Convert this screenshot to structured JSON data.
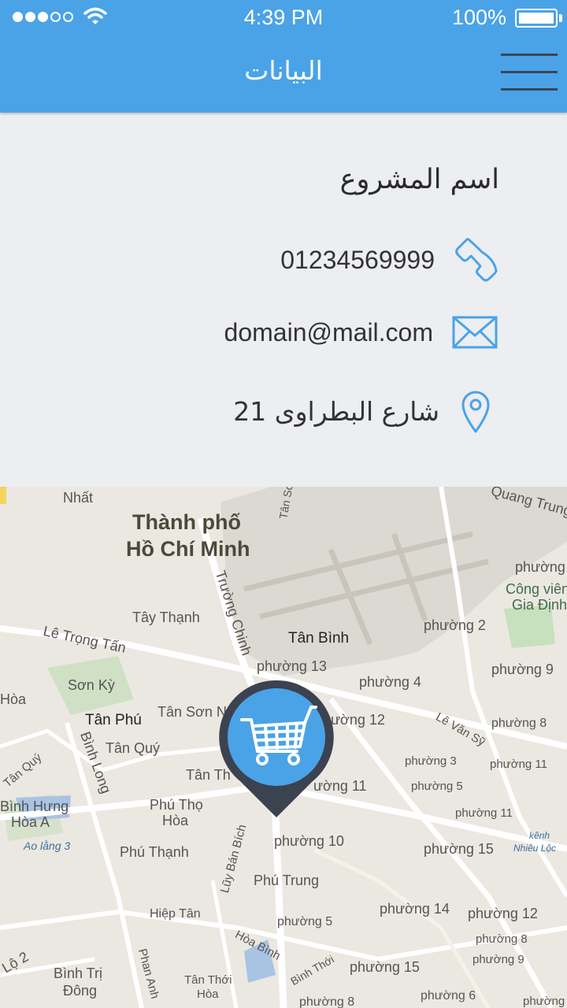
{
  "status_bar": {
    "time": "4:39 PM",
    "battery": "100%"
  },
  "header": {
    "title": "البيانات"
  },
  "contact": {
    "project_name": "اسم المشروع",
    "phone": "01234569999",
    "email": "domain@mail.com",
    "address": "21 شارع البطراوى"
  },
  "icons": {
    "phone": "phone-icon",
    "email": "envelope-icon",
    "address": "location-pin-icon",
    "pin": "shopping-cart-icon"
  },
  "colors": {
    "accent": "#4aa3e6",
    "pin_dark": "#3b4250"
  },
  "map": {
    "labels": {
      "nhat": "Nhất",
      "city1": "Thành phố",
      "city2": "Hồ Chí Minh",
      "tan_sn": "Tân Sơ",
      "quang_trung": "Quang Trung",
      "phuong_tr": "phường",
      "cong_vien": "Công viên",
      "gia_dinh": "Gia Định",
      "truong_chinh": "Trường Chinh",
      "tay_thanh": "Tây Thạnh",
      "le_trong_tan": "Lê Trọng Tấn",
      "tan_binh": "Tân Bình",
      "p2": "phường 2",
      "p13": "phường 13",
      "p9a": "phường 9",
      "son_ky": "Sơn Kỳ",
      "p4": "phường 4",
      "hoa": "Hòa",
      "tan_phu": "Tân Phú",
      "tan_son_n": "Tân Sơn N",
      "p12a": "ường 12",
      "le_van_sy": "Lê Văn Sỹ",
      "p8": "phường 8",
      "tan_quy": "Tân Quý",
      "binh_long": "Bình Long",
      "tan_quy2": "Tân Quý",
      "p3": "phường 3",
      "p11a": "phường 11",
      "tan_th": "Tân Th",
      "p11b": "ường 11",
      "p5a": "phường 5",
      "binh_hung": "Bình Hưng",
      "hoa_a": "Hòa A",
      "phu_tho": "Phú Thọ",
      "hoa2": "Hòa",
      "p11c": "phường 11",
      "ao_lang": "Ao lằng 3",
      "p10": "phường 10",
      "kenh": "kênh",
      "nhieu_loc": "Nhiêu Lộc",
      "phu_thanh": "Phú Thạnh",
      "luy_ban_bich": "Lũy Bán Bích",
      "p15a": "phường 15",
      "phu_trung": "Phú Trung",
      "p14": "phường 14",
      "p12b": "phường 12",
      "hiep_tan": "Hiệp Tân",
      "p5b": "phường 5",
      "hoa_binh": "Hòa Bình",
      "p8b": "phường 8",
      "p9b": "phường 9",
      "lo2": "Lộ 2",
      "binh_tri": "Bình Trị",
      "dong": "Đông",
      "phan_anh": "Phan Anh",
      "tan_thoi": "Tân Thới",
      "hoa3": "Hòa",
      "binh_thoi": "Bình Thới",
      "p15b": "phường 15",
      "p6": "phường 6",
      "p8c": "phường 8",
      "phuong_b": "phường"
    }
  }
}
